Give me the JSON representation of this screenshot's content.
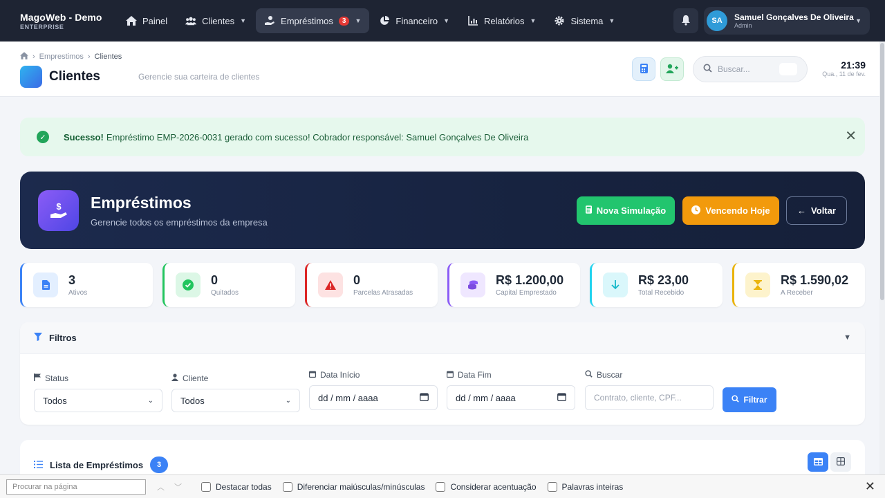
{
  "navbar": {
    "brand_name": "MagoWeb - Demo",
    "brand_sub": "ENTERPRISE",
    "items": [
      {
        "label": "Painel"
      },
      {
        "label": "Clientes"
      },
      {
        "label": "Empréstimos",
        "badge": "3"
      },
      {
        "label": "Financeiro"
      },
      {
        "label": "Relatórios"
      },
      {
        "label": "Sistema"
      }
    ],
    "user": {
      "initials": "SA",
      "name": "Samuel Gonçalves De Oliveira",
      "role": "Admin"
    }
  },
  "page_header": {
    "breadcrumb": [
      "Emprestimos",
      "Clientes"
    ],
    "title": "Clientes",
    "subtitle": "Gerencie sua carteira de clientes",
    "search_placeholder": "Buscar...",
    "time": "21:39",
    "date": "Qua., 11 de fev."
  },
  "alert": {
    "strong": "Sucesso!",
    "message": "Empréstimo EMP-2026-0031 gerado com sucesso! Cobrador responsável: Samuel Gonçalves De Oliveira"
  },
  "hero": {
    "title": "Empréstimos",
    "subtitle": "Gerencie todos os empréstimos da empresa",
    "btn_new": "Nova Simulação",
    "btn_due": "Vencendo Hoje",
    "btn_back": "Voltar"
  },
  "stats": [
    {
      "value": "3",
      "label": "Ativos",
      "color": "#3b82f6"
    },
    {
      "value": "0",
      "label": "Quitados",
      "color": "#22c55e"
    },
    {
      "value": "0",
      "label": "Parcelas Atrasadas",
      "color": "#dc2626"
    },
    {
      "value": "R$ 1.200,00",
      "label": "Capital Emprestado",
      "color": "#8b5cf6"
    },
    {
      "value": "R$ 23,00",
      "label": "Total Recebido",
      "color": "#22d3ee"
    },
    {
      "value": "R$ 1.590,02",
      "label": "A Receber",
      "color": "#eab308"
    }
  ],
  "filters": {
    "title": "Filtros",
    "status_label": "Status",
    "status_value": "Todos",
    "cliente_label": "Cliente",
    "cliente_value": "Todos",
    "inicio_label": "Data Início",
    "inicio_placeholder": "dd / mm / aaaa",
    "fim_label": "Data Fim",
    "fim_placeholder": "dd / mm / aaaa",
    "buscar_label": "Buscar",
    "buscar_placeholder": "Contrato, cliente, CPF...",
    "button": "Filtrar"
  },
  "list": {
    "title": "Lista de Empréstimos",
    "count": "3"
  },
  "findbar": {
    "placeholder": "Procurar na página",
    "highlight_all": "Destacar todas",
    "match_case": "Diferenciar maiúsculas/minúsculas",
    "accents": "Considerar acentuação",
    "whole_words": "Palavras inteiras"
  }
}
